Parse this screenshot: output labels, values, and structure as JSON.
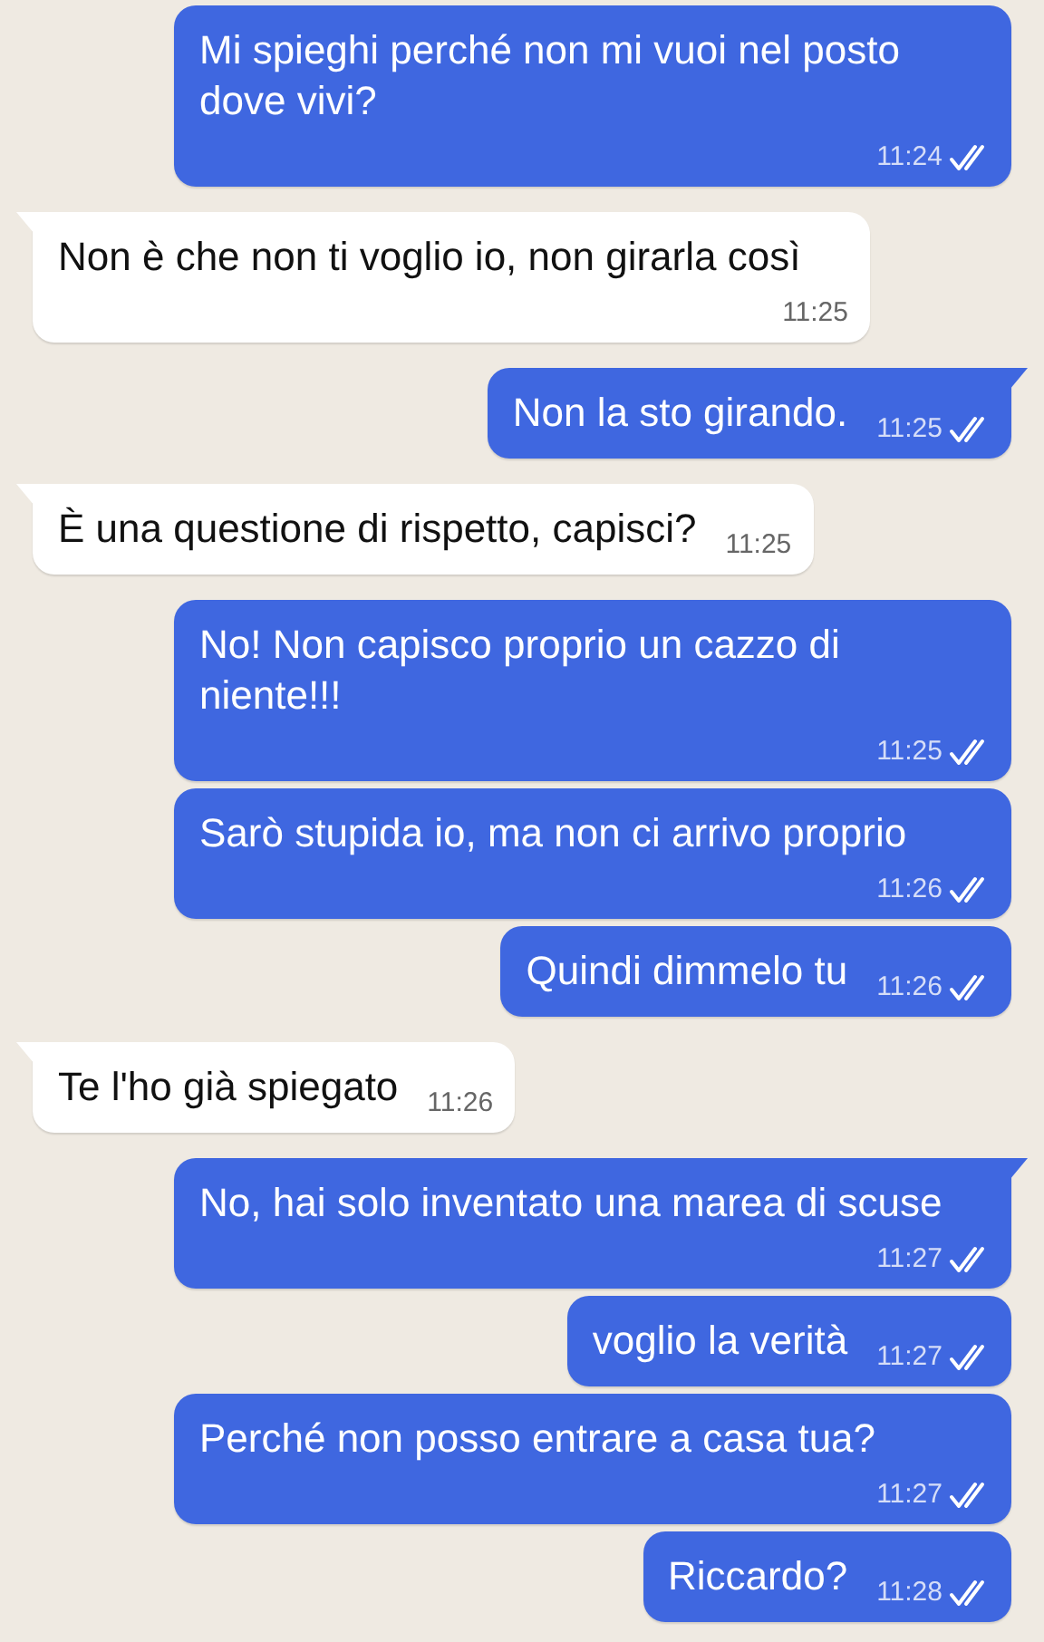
{
  "messages": [
    {
      "kind": "sent",
      "tail": false,
      "text": "Mi spieghi perché non mi vuoi nel posto dove vivi?",
      "time": "11:24",
      "read": true
    },
    {
      "kind": "received",
      "tail": true,
      "text": "Non è che non ti voglio io, non girarla così",
      "time": "11:25"
    },
    {
      "kind": "sent",
      "tail": true,
      "text": "Non la sto girando.",
      "time": "11:25",
      "read": true
    },
    {
      "kind": "received",
      "tail": true,
      "text": "È una questione di rispetto, capisci?",
      "time": "11:25"
    },
    {
      "kind": "sent",
      "tail": false,
      "text": "No! Non capisco proprio un cazzo di niente!!!",
      "time": "11:25",
      "read": true
    },
    {
      "kind": "sent",
      "tail": false,
      "text": "Sarò stupida io, ma non ci arrivo proprio",
      "time": "11:26",
      "read": true
    },
    {
      "kind": "sent",
      "tail": false,
      "text": "Quindi dimmelo tu",
      "time": "11:26",
      "read": true
    },
    {
      "kind": "received",
      "tail": true,
      "text": "Te l'ho già spiegato",
      "time": "11:26"
    },
    {
      "kind": "sent",
      "tail": true,
      "text": "No, hai solo inventato una marea di scuse",
      "time": "11:27",
      "read": true
    },
    {
      "kind": "sent",
      "tail": false,
      "text": "voglio la verità",
      "time": "11:27",
      "read": true
    },
    {
      "kind": "sent",
      "tail": false,
      "text": "Perché non posso entrare a casa tua?",
      "time": "11:27",
      "read": true
    },
    {
      "kind": "sent",
      "tail": false,
      "text": "Riccardo?",
      "time": "11:28",
      "read": true
    }
  ]
}
